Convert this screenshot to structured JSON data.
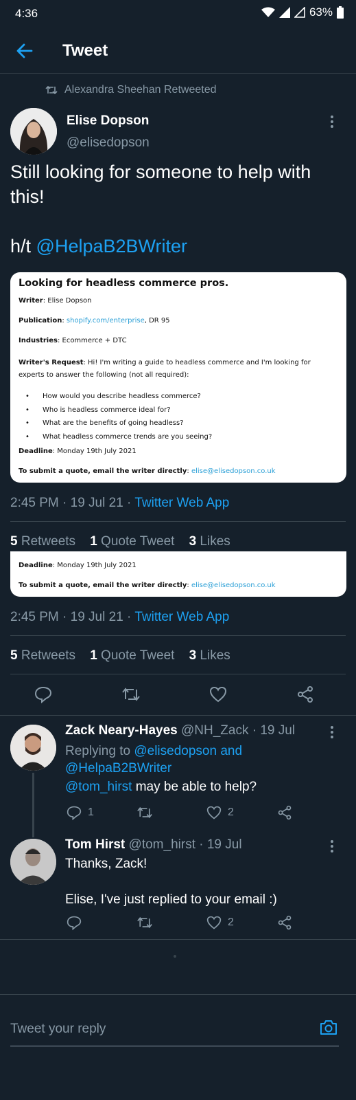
{
  "status": {
    "time": "4:36",
    "battery": "63%"
  },
  "header": {
    "title": "Tweet"
  },
  "retweet_by": "Alexandra Sheehan Retweeted",
  "tweet": {
    "name": "Elise Dopson",
    "handle": "@elisedopson",
    "text_line1": "Still looking for someone to help with",
    "text_line2": "this!",
    "ht_prefix": "h/t ",
    "ht_mention": "@HelpaB2BWriter"
  },
  "card": {
    "title": "Looking for headless commerce pros.",
    "writer_label": "Writer",
    "writer_value": ": Elise Dopson",
    "publication_label": "Publication",
    "publication_link": "shopify.com/enterprise",
    "publication_rest": ", DR 95",
    "industries_label": "Industries",
    "industries_value": ": Ecommerce + DTC",
    "request_label": "Writer's Request",
    "request_value": ": Hi! I'm writing a guide to headless commerce and I'm looking for experts to answer the following (not all required):",
    "bullets": [
      "How would you describe headless commerce?",
      "Who is headless commerce ideal for?",
      "What are the benefits of going headless?",
      "What headless commerce trends are you seeing?"
    ],
    "deadline_label": "Deadline",
    "deadline_value": ": Monday 19th July 2021",
    "submit_label": "To submit a quote, email the writer directly",
    "submit_sep": ": ",
    "email": "elise@elisedopson.co.uk"
  },
  "meta": {
    "time": "2:45 PM · 19 Jul 21 · ",
    "app": "Twitter Web App"
  },
  "stats": {
    "retweets_count": "5",
    "retweets_label": " Retweets",
    "quotes_count": "1",
    "quotes_label": " Quote Tweet",
    "likes_count": "3",
    "likes_label": " Likes"
  },
  "replies": [
    {
      "name": "Zack Neary-Hayes",
      "handle_time": "@NH_Zack · 19 Jul",
      "replying_prefix": "Replying to ",
      "replying_to1": "@elisedopson and",
      "replying_to2": "@HelpaB2BWriter",
      "mention": "@tom_hirst",
      "text": " may be able to help?",
      "reply_count": "1",
      "like_count": "2"
    },
    {
      "name": "Tom Hirst",
      "handle_time": "@tom_hirst · 19 Jul",
      "line1": "Thanks, Zack!",
      "line2": "Elise, I've just replied to your email :)",
      "like_count": "2"
    }
  ],
  "reply_input": {
    "placeholder": "Tweet your reply"
  },
  "colors": {
    "bg": "#15202b",
    "accent": "#1da1f2",
    "muted": "#8899a6",
    "divider": "#38444d"
  }
}
